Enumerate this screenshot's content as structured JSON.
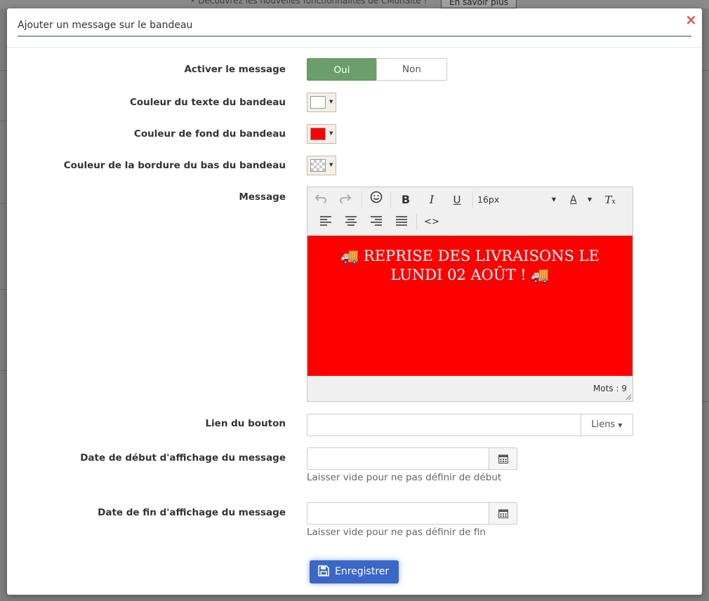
{
  "background": {
    "notice_text": "⚡ Découvrez les nouvelles fonctionnalités de CMonSite !",
    "more_button": "En savoir plus"
  },
  "modal": {
    "title": "Ajouter un message sur le bandeau",
    "close_glyph": "×",
    "activate": {
      "label": "Activer le message",
      "on_label": "Oui",
      "off_label": "Non",
      "selected": "Oui"
    },
    "text_color": {
      "label": "Couleur du texte du bandeau",
      "value": "#ffffff"
    },
    "bg_color": {
      "label": "Couleur de fond du bandeau",
      "value": "#ff0000"
    },
    "border_color": {
      "label": "Couleur de la bordure du bas du bandeau",
      "value": "transparent"
    },
    "message": {
      "label": "Message",
      "toolbar": {
        "font_size": "16px",
        "icons": [
          "undo-icon",
          "redo-icon",
          "emoji-icon",
          "bold-icon",
          "italic-icon",
          "underline-icon",
          "font-size-select",
          "text-color-icon",
          "clear-format-icon",
          "align-left-icon",
          "align-center-icon",
          "align-right-icon",
          "justify-icon",
          "code-icon"
        ]
      },
      "content_line1": "🚚  REPRISE DES LIVRAISONS LE",
      "content_line2": "LUNDI 02 AOÛT ! 🚚",
      "word_count": "Mots : 9"
    },
    "link": {
      "label": "Lien du bouton",
      "value": "",
      "addon": "Liens"
    },
    "start_date": {
      "label": "Date de début d'affichage du message",
      "value": "",
      "help": "Laisser vide pour ne pas définir de début"
    },
    "end_date": {
      "label": "Date de fin d'affichage du message",
      "value": "",
      "help": "Laisser vide pour ne pas définir de fin"
    },
    "save_label": "Enregistrer"
  },
  "colors": {
    "accent": "#3a67c8",
    "toggle_on": "#6b9e6b",
    "close": "#e0524c",
    "banner_bg": "#ff0000"
  }
}
